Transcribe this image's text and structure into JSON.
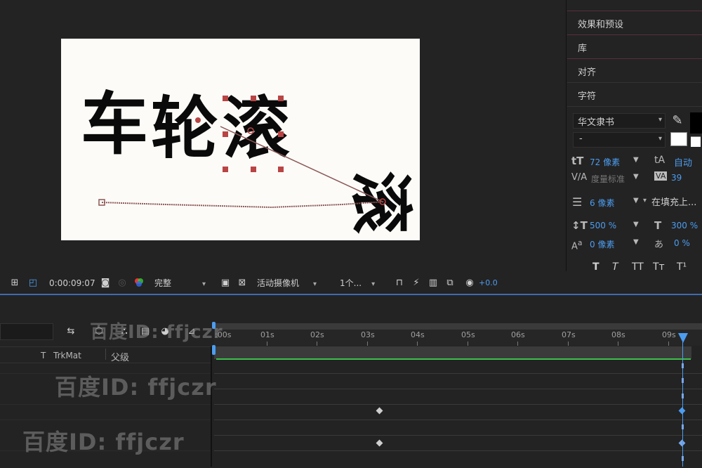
{
  "viewer": {
    "comp_chars": [
      "车",
      "轮",
      "滚"
    ],
    "timecode": "0:00:09:07",
    "resolution": "完整",
    "camera": "活动摄像机",
    "views": "1个...",
    "exposure": "+0.0"
  },
  "panels": {
    "effects": "效果和预设",
    "library": "库",
    "align": "对齐",
    "character": "字符"
  },
  "character": {
    "font_family": "华文隶书",
    "font_style": "-",
    "font_size": "72 像素",
    "leading": "自动",
    "kerning": "度量标准",
    "tracking": "39",
    "stroke_width": "6 像素",
    "stroke_mode": "在填充上...",
    "vert_scale": "500 %",
    "horiz_scale": "300 %",
    "baseline": "0 像素",
    "tsume": "0 %",
    "styles": [
      "T",
      "T",
      "TT",
      "Tт",
      "T¹"
    ]
  },
  "timeline": {
    "col_trkmat": "TrkMat",
    "col_parent": "父级",
    "col_t": "T",
    "ticks": [
      ":00s",
      "01s",
      "02s",
      "03s",
      "04s",
      "05s",
      "06s",
      "07s",
      "08s",
      "09s"
    ]
  },
  "watermark": "百度ID: ffjczr",
  "colors": {
    "accent": "#4c9df0",
    "handle": "#b94444",
    "work_area": "#3cc14b"
  }
}
